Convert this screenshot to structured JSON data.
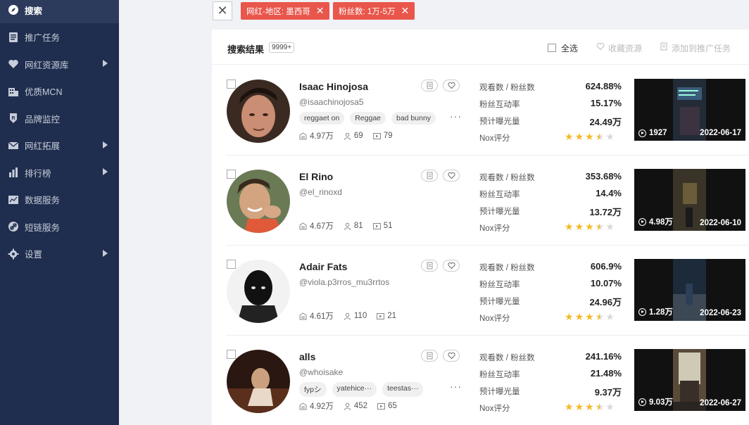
{
  "sidebar": {
    "items": [
      {
        "label": "搜索",
        "icon": "search-icon",
        "has_arrow": false,
        "active": true
      },
      {
        "label": "推广任务",
        "icon": "document-icon",
        "has_arrow": false
      },
      {
        "label": "网红资源库",
        "icon": "heart-icon",
        "has_arrow": true
      },
      {
        "label": "优质MCN",
        "icon": "building-icon",
        "has_arrow": false
      },
      {
        "label": "品牌监控",
        "icon": "shield-icon",
        "has_arrow": false
      },
      {
        "label": "网红拓展",
        "icon": "mail-icon",
        "has_arrow": true
      },
      {
        "label": "排行榜",
        "icon": "bar-chart-icon",
        "has_arrow": true
      },
      {
        "label": "数据服务",
        "icon": "line-chart-icon",
        "has_arrow": false
      },
      {
        "label": "短链服务",
        "icon": "link-icon",
        "has_arrow": false
      },
      {
        "label": "设置",
        "icon": "gear-icon",
        "has_arrow": true
      }
    ]
  },
  "filters": {
    "tags": [
      "网红-地区: 墨西哥",
      "粉丝数: 1万-5万"
    ]
  },
  "results": {
    "title": "搜索结果",
    "count": "9999+",
    "select_all": "全选",
    "favorite_label": "收藏资源",
    "add_task_label": "添加到推广任务"
  },
  "metric_labels": {
    "views_ratio": "观看数 / 粉丝数",
    "engagement": "粉丝互动率",
    "exposure": "预计曝光量",
    "score": "Nox评分"
  },
  "creators": [
    {
      "name": "Isaac Hinojosa",
      "handle": "@isaachinojosa5",
      "tags": [
        "reggaet on",
        "Reggae",
        "bad bunny"
      ],
      "followers": "4.97万",
      "likes": "69",
      "videos": "79",
      "views_ratio": "624.88%",
      "engagement": "15.17%",
      "exposure": "24.49万",
      "rating": 3.5,
      "video_views": "1927",
      "video_date": "2022-06-17"
    },
    {
      "name": "El Rino",
      "handle": "@el_rinoxd",
      "tags": [],
      "followers": "4.67万",
      "likes": "81",
      "videos": "51",
      "views_ratio": "353.68%",
      "engagement": "14.4%",
      "exposure": "13.72万",
      "rating": 3.5,
      "video_views": "4.98万",
      "video_date": "2022-06-10"
    },
    {
      "name": "Adair Fats",
      "handle": "@viola.p3rros_mu3rrtos",
      "tags": [],
      "followers": "4.61万",
      "likes": "110",
      "videos": "21",
      "views_ratio": "606.9%",
      "engagement": "10.07%",
      "exposure": "24.96万",
      "rating": 3.5,
      "video_views": "1.28万",
      "video_date": "2022-06-23"
    },
    {
      "name": "alls",
      "handle": "@whoisake",
      "tags": [
        "fypシ",
        "yatehice···",
        "teestas···"
      ],
      "followers": "4.92万",
      "likes": "452",
      "videos": "65",
      "views_ratio": "241.16%",
      "engagement": "21.48%",
      "exposure": "9.37万",
      "rating": 3.5,
      "video_views": "9.03万",
      "video_date": "2022-06-27"
    }
  ],
  "colors": {
    "sidebar_bg": "#1f2d4e",
    "filter_tag": "#e9564b",
    "star": "#f5b823",
    "star_empty": "#d9d9d9"
  }
}
